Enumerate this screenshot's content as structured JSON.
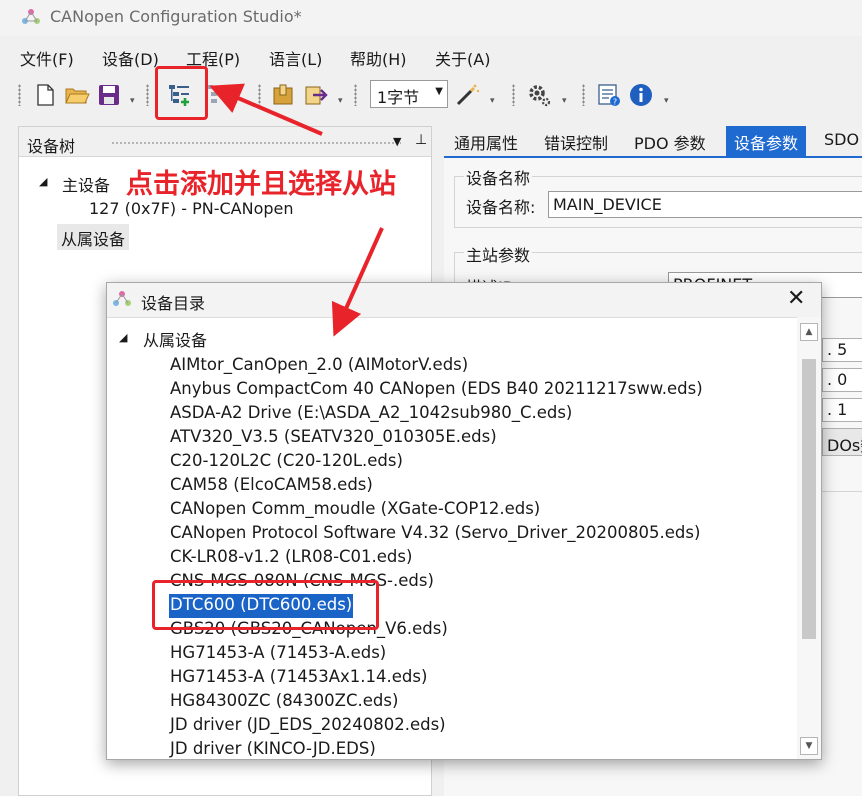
{
  "window": {
    "title": "CANopen Configuration Studio*"
  },
  "menu": [
    {
      "label": "文件(F)"
    },
    {
      "label": "设备(D)"
    },
    {
      "label": "工程(P)"
    },
    {
      "label": "语言(L)"
    },
    {
      "label": "帮助(H)"
    },
    {
      "label": "关于(A)"
    }
  ],
  "toolbar": {
    "byte_select": "1字节",
    "icons": [
      "new-file-icon",
      "open-folder-icon",
      "save-icon",
      "add-device-icon",
      "remove-device-icon",
      "import-icon",
      "export-icon",
      "wand-icon",
      "settings-gear-icon",
      "catalog-info-icon",
      "info-icon"
    ]
  },
  "device_tree": {
    "title": "设备树",
    "master_label": "主设备",
    "master_node": "127 (0x7F)  -  PN-CANopen",
    "slave_label": "从属设备"
  },
  "tabs": [
    {
      "label": "通用属性"
    },
    {
      "label": "错误控制"
    },
    {
      "label": "PDO 参数"
    },
    {
      "label": "设备参数"
    },
    {
      "label": "SDO"
    }
  ],
  "device_params": {
    "group_name_title": "设备名称",
    "device_name_label": "设备名称:",
    "device_name_value": "MAIN_DEVICE",
    "master_group_title": "主站参数",
    "partial_label": "描述ID",
    "partial_value": "PROFINET",
    "partial_right": [
      ". 5",
      ". 0",
      ". 1",
      "DOs数"
    ]
  },
  "catalog": {
    "title": "设备目录",
    "root_label": "从属设备",
    "items": [
      "AIMtor_CanOpen_2.0 (AIMotorV.eds)",
      "Anybus CompactCom 40 CANopen (EDS B40 20211217sww.eds)",
      "ASDA-A2 Drive (E:\\ASDA_A2_1042sub980_C.eds)",
      "ATV320_V3.5 (SEATV320_010305E.eds)",
      "C20-120L2C (C20-120L.eds)",
      "CAM58 (ElcoCAM58.eds)",
      "CANopen Comm_moudle (XGate-COP12.eds)",
      "CANopen Protocol Software V4.32 (Servo_Driver_20200805.eds)",
      "CK-LR08-v1.2 (LR08-C01.eds)",
      "CNS-MGS-080N (CNS-MGS-.eds)",
      "DTC600 (DTC600.eds)",
      "GBS20 (GBS20_CANopen_V6.eds)",
      "HG71453-A (71453-A.eds)",
      "HG71453-A (71453Ax1.14.eds)",
      "HG84300ZC (84300ZC.eds)",
      "JD driver (JD_EDS_20240802.eds)",
      "JD driver (KINCO-JD.EDS)"
    ],
    "selected_index": 10
  },
  "annotation": {
    "text": "点击添加并且选择从站",
    "color": "#e8232a"
  },
  "colors": {
    "accent": "#1f6ad1",
    "selection": "#1a64c8",
    "annotation": "#e8232a"
  }
}
